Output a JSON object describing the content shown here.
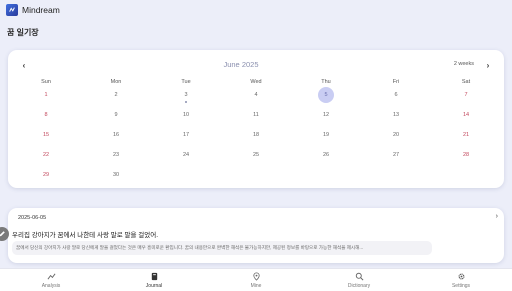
{
  "app": {
    "title": "Mindream"
  },
  "section_title": "꿈 일기장",
  "calendar": {
    "month_title": "June 2025",
    "format_label": "2 weeks",
    "weekdays": [
      "Sun",
      "Mon",
      "Tue",
      "Wed",
      "Thu",
      "Fri",
      "Sat"
    ],
    "weeks": [
      [
        "1",
        "2",
        "3",
        "4",
        "5",
        "6",
        "7"
      ],
      [
        "8",
        "9",
        "10",
        "11",
        "12",
        "13",
        "14"
      ],
      [
        "15",
        "16",
        "17",
        "18",
        "19",
        "20",
        "21"
      ],
      [
        "22",
        "23",
        "24",
        "25",
        "26",
        "27",
        "28"
      ],
      [
        "29",
        "30",
        "",
        "",
        "",
        "",
        ""
      ]
    ],
    "today": "5",
    "event_days": [
      "3"
    ],
    "colors": {
      "weekend": "#c2475c",
      "today_bg": "#c9cdf3",
      "title": "#8a8fae"
    }
  },
  "entry": {
    "date": "2025-06-05",
    "title": "우리집 강아지가 꿈에서 나한테 사랑 말로 말을 걸었어.",
    "excerpt": "꿈에서 당신의 강아지가 사랑 말로 당신에게 말을 걸었다는 것은 매우 흥미로운 환입니다. 꿈의 내용만으로 완벽한 해석은 불가능하지만, 제공된 정보를 바탕으로 가능한 해석을 제시해..."
  },
  "nav": [
    {
      "key": "analysis",
      "label": "Analysis",
      "icon": "analysis-icon"
    },
    {
      "key": "journal",
      "label": "Journal",
      "icon": "journal-icon",
      "active": true
    },
    {
      "key": "mine",
      "label": "Mine",
      "icon": "location-pin-icon"
    },
    {
      "key": "dictionary",
      "label": "Dictionary",
      "icon": "search-icon"
    },
    {
      "key": "settings",
      "label": "Settings",
      "icon": "gear-icon"
    }
  ]
}
